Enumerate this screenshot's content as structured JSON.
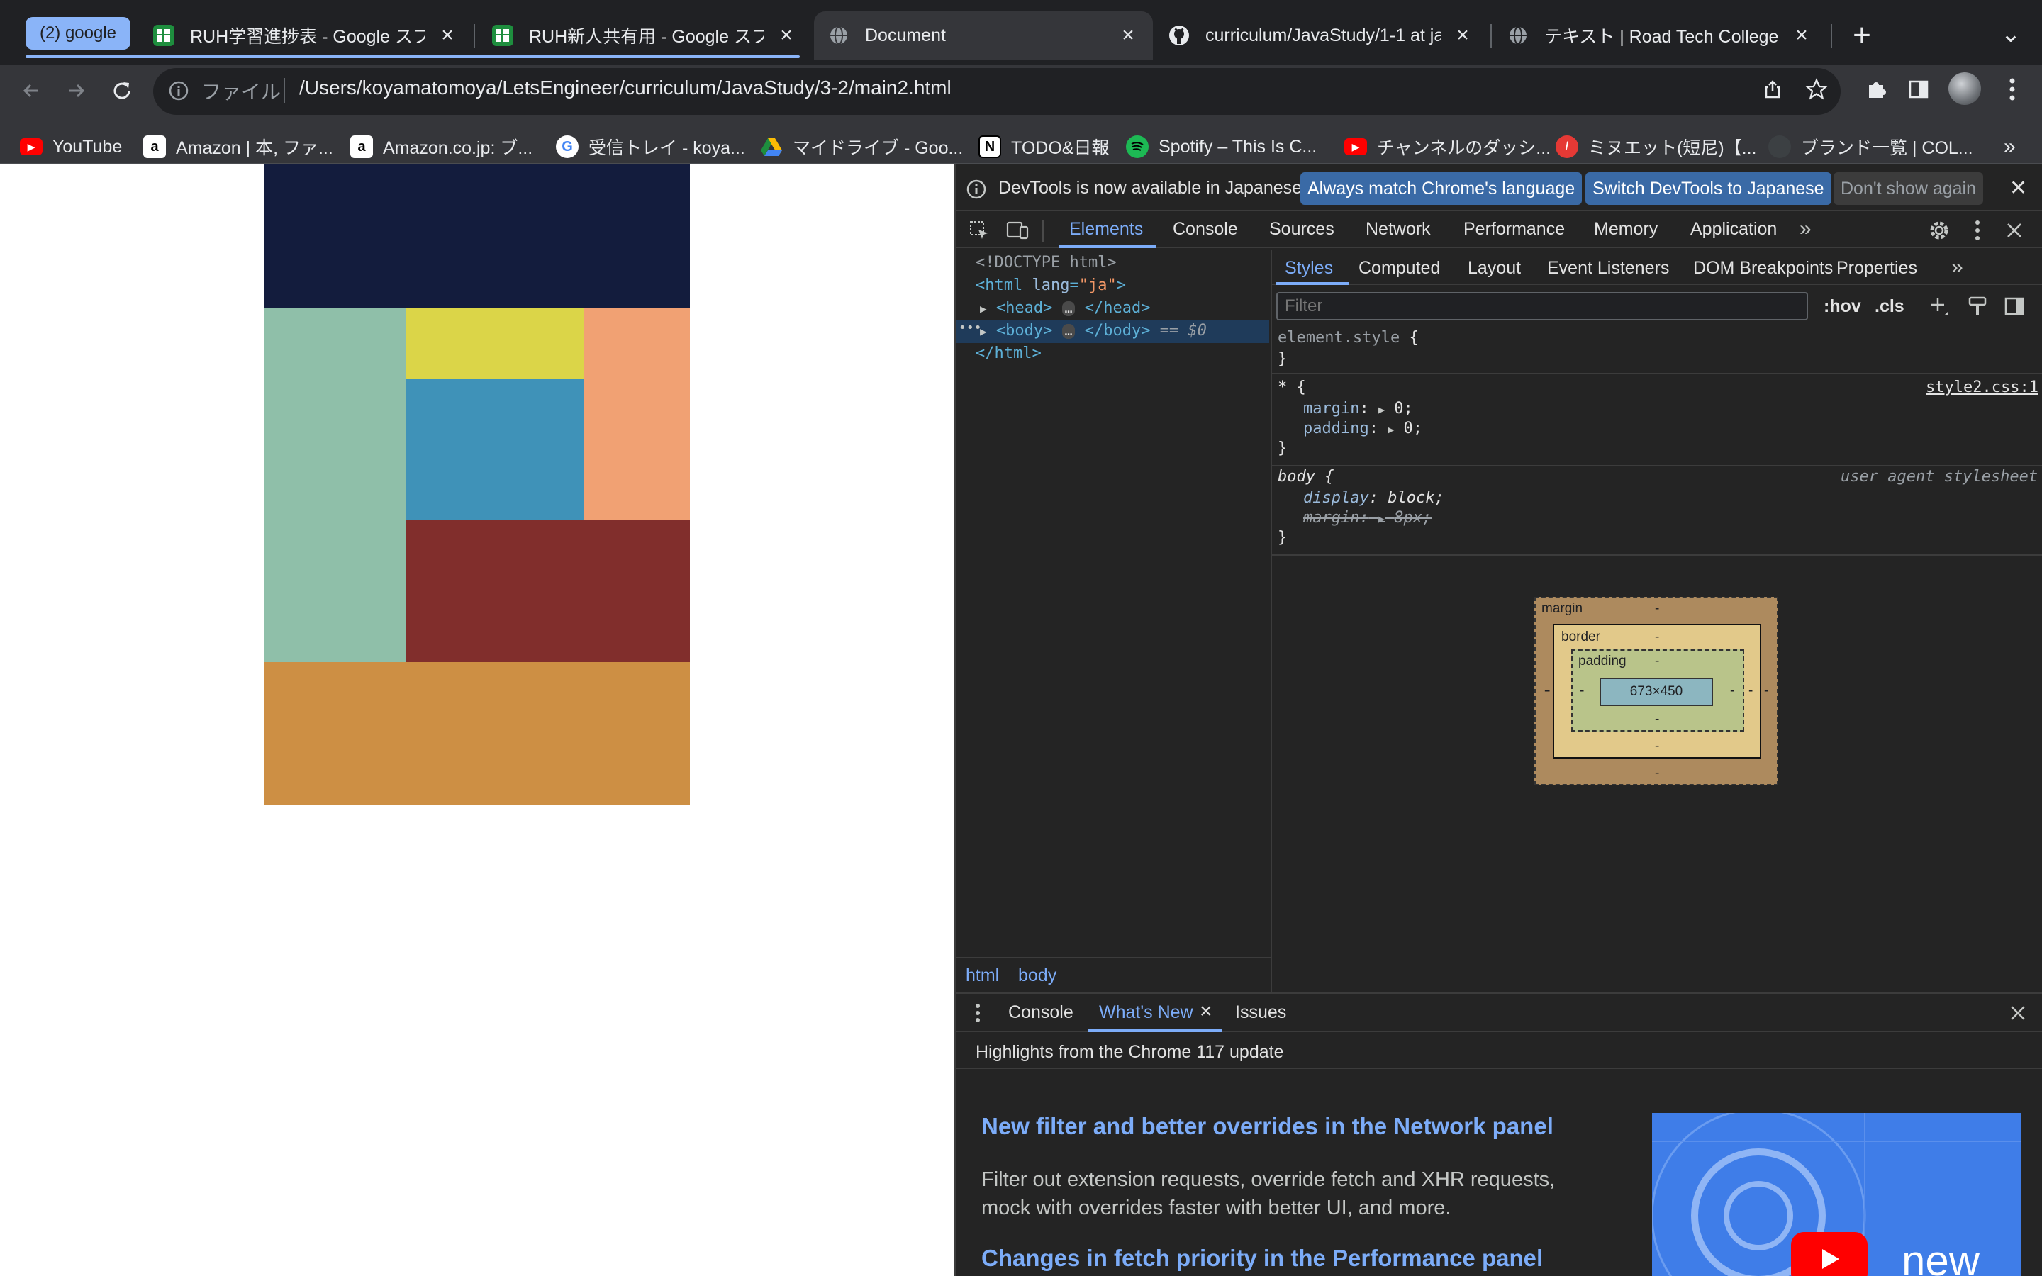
{
  "browser": {
    "tabs": [
      {
        "label": "RUH学習進捗表 - Google スプレ",
        "favicon": "sheets-icon"
      },
      {
        "label": "RUH新人共有用 - Google スプレ",
        "favicon": "sheets-icon"
      },
      {
        "label": "Document",
        "favicon": "globe-icon"
      },
      {
        "label": "curriculum/JavaStudy/1-1 at ja",
        "favicon": "github-icon"
      },
      {
        "label": "テキスト | Road Tech College",
        "favicon": "globe-icon"
      }
    ],
    "tab_group_label": "(2) google",
    "new_tab": "+",
    "tab_menu": "⌄",
    "address": {
      "scheme_label": "ファイル",
      "url": "/Users/koyamatomoya/LetsEngineer/curriculum/JavaStudy/3-2/main2.html"
    },
    "bookmarks": [
      {
        "label": "YouTube"
      },
      {
        "label": "Amazon | 本, ファ..."
      },
      {
        "label": "Amazon.co.jp: ブ..."
      },
      {
        "label": "受信トレイ - koya..."
      },
      {
        "label": "マイドライブ - Goo..."
      },
      {
        "label": "TODO&日報"
      },
      {
        "label": "Spotify – This Is C..."
      },
      {
        "label": "チャンネルのダッシ..."
      },
      {
        "label": "ミヌエット(短尼)【..."
      },
      {
        "label": "ブランド一覧 | COL..."
      }
    ],
    "bookmarks_more": "»"
  },
  "page": {
    "blocks": [
      {
        "name": "navy-block",
        "color": "#131c3d"
      },
      {
        "name": "mint-block",
        "color": "#8fbfa9"
      },
      {
        "name": "yellow-block",
        "color": "#dbd548"
      },
      {
        "name": "blue-block",
        "color": "#3f92b8"
      },
      {
        "name": "salmon-block",
        "color": "#f1a173"
      },
      {
        "name": "maroon-block",
        "color": "#812e2c"
      },
      {
        "name": "orange-block",
        "color": "#cd8f44"
      }
    ]
  },
  "devtools": {
    "infobar": {
      "message": "DevTools is now available in Japanese!",
      "btn_match": "Always match Chrome's language",
      "btn_switch": "Switch DevTools to Japanese",
      "btn_dismiss": "Don't show again",
      "close": "✕"
    },
    "main_tabs": [
      "Elements",
      "Console",
      "Sources",
      "Network",
      "Performance",
      "Memory",
      "Application"
    ],
    "more": "»",
    "dom": {
      "doctype": "<!DOCTYPE html>",
      "html_open_tag": "<html",
      "html_attr_name": "lang",
      "html_attr_eq": "=",
      "html_attr_value": "\"ja\"",
      "html_open_end": ">",
      "head_open": "<head>",
      "head_close": "</head>",
      "body_open": "<body>",
      "body_close": "</body>",
      "selected_marker": "== $0",
      "html_close": "</html>",
      "ellipsis": "…"
    },
    "breadcrumb": [
      "html",
      "body"
    ],
    "style_tabs": [
      "Styles",
      "Computed",
      "Layout",
      "Event Listeners",
      "DOM Breakpoints",
      "Properties"
    ],
    "filter_placeholder": "Filter",
    "hov": ":hov",
    "cls": ".cls",
    "rules": {
      "element_style": "element.style",
      "universal_selector": "*",
      "universal_source": "style2.css:1",
      "margin_prop": "margin",
      "padding_prop": "padding",
      "zero_value": "0;",
      "body_selector": "body",
      "ua_label": "user agent stylesheet",
      "display_prop": "display",
      "display_value": "block;",
      "margin_value_struck": "8px;",
      "open_brace": "{",
      "close_brace": "}",
      "colon": ":"
    },
    "box_model": {
      "margin_label": "margin",
      "border_label": "border",
      "padding_label": "padding",
      "content_size": "673×450",
      "dash": "-"
    },
    "drawer": {
      "tabs": [
        "Console",
        "What's New",
        "Issues"
      ],
      "highlights": "Highlights from the Chrome 117 update",
      "article1_title": "New filter and better overrides in the Network panel",
      "article1_body_line1": "Filter out extension requests, override fetch and XHR requests,",
      "article1_body_line2": "mock with overrides faster with better UI, and more.",
      "article2_title": "Changes in fetch priority in the Performance panel",
      "video_label": "new"
    }
  }
}
